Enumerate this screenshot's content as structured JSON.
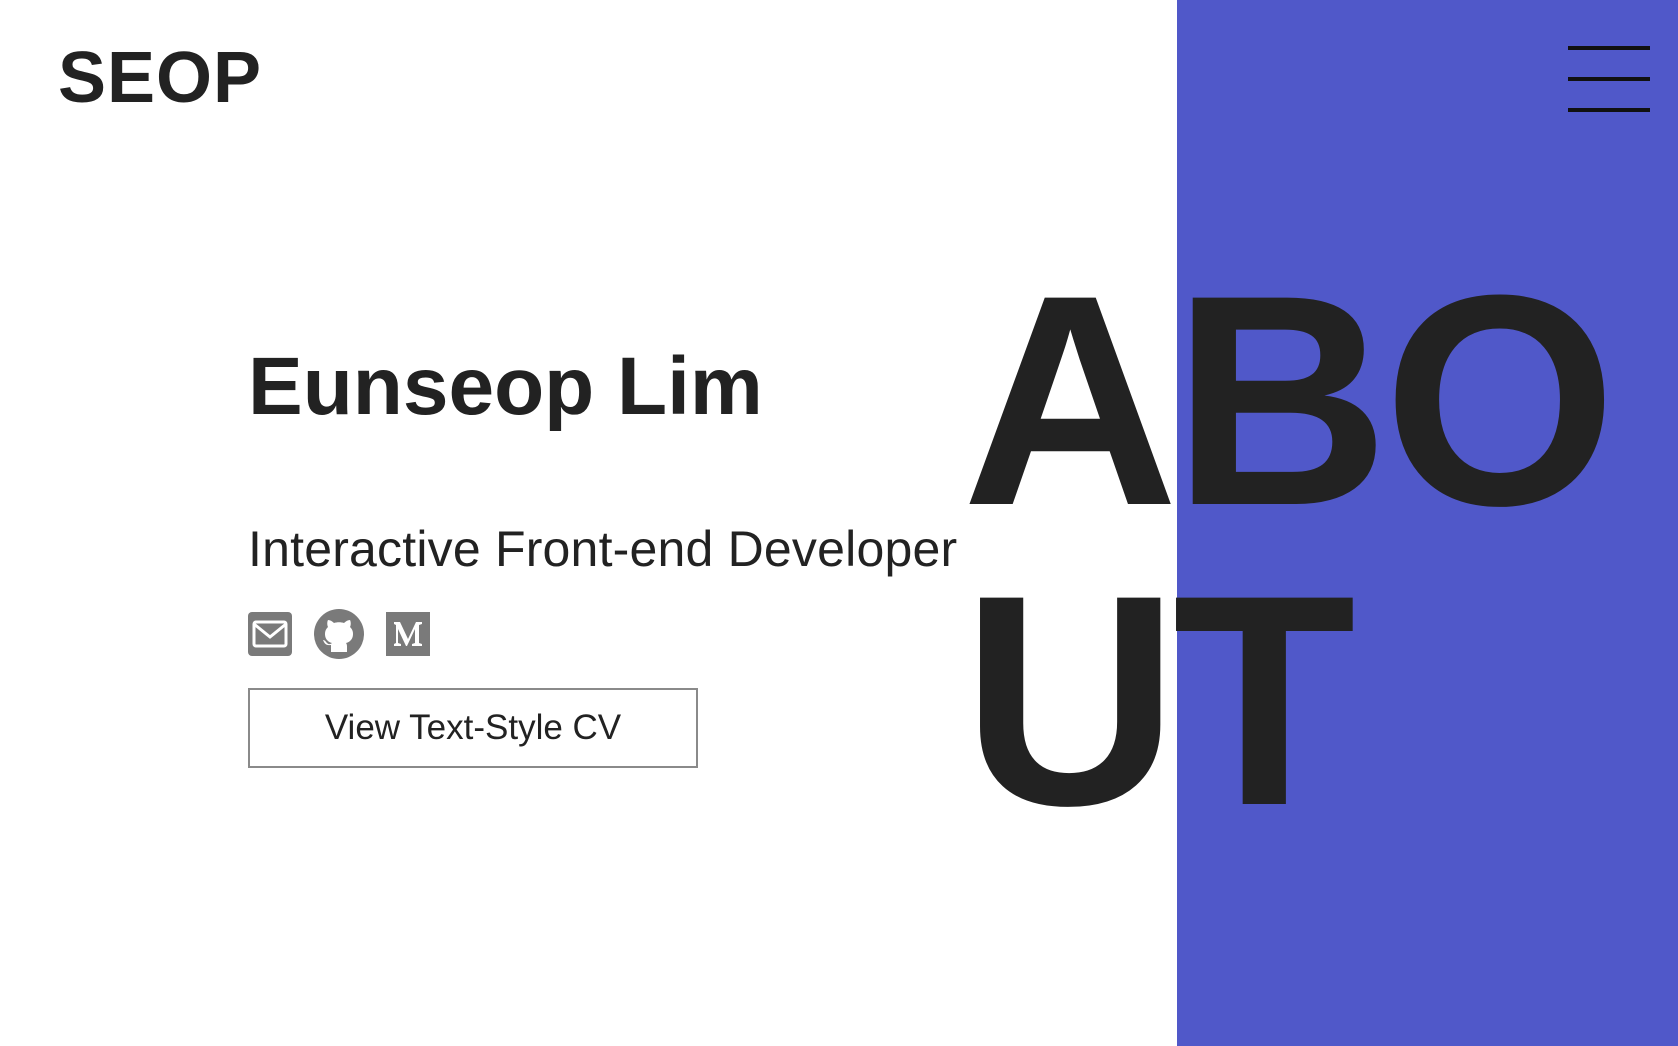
{
  "header": {
    "logo": "SEOP",
    "menu_icon": "hamburger-menu-icon"
  },
  "profile": {
    "name": "Eunseop Lim",
    "role": "Interactive Front-end Developer",
    "social": [
      {
        "icon": "mail-icon"
      },
      {
        "icon": "github-icon"
      },
      {
        "icon": "medium-icon"
      }
    ],
    "cv_button_label": "View Text-Style CV"
  },
  "section": {
    "title_line1": "ABO",
    "title_line2": "UT"
  },
  "colors": {
    "accent": "#5058c9",
    "text": "#222222",
    "icon": "#7a7a7a",
    "background": "#ffffff"
  }
}
